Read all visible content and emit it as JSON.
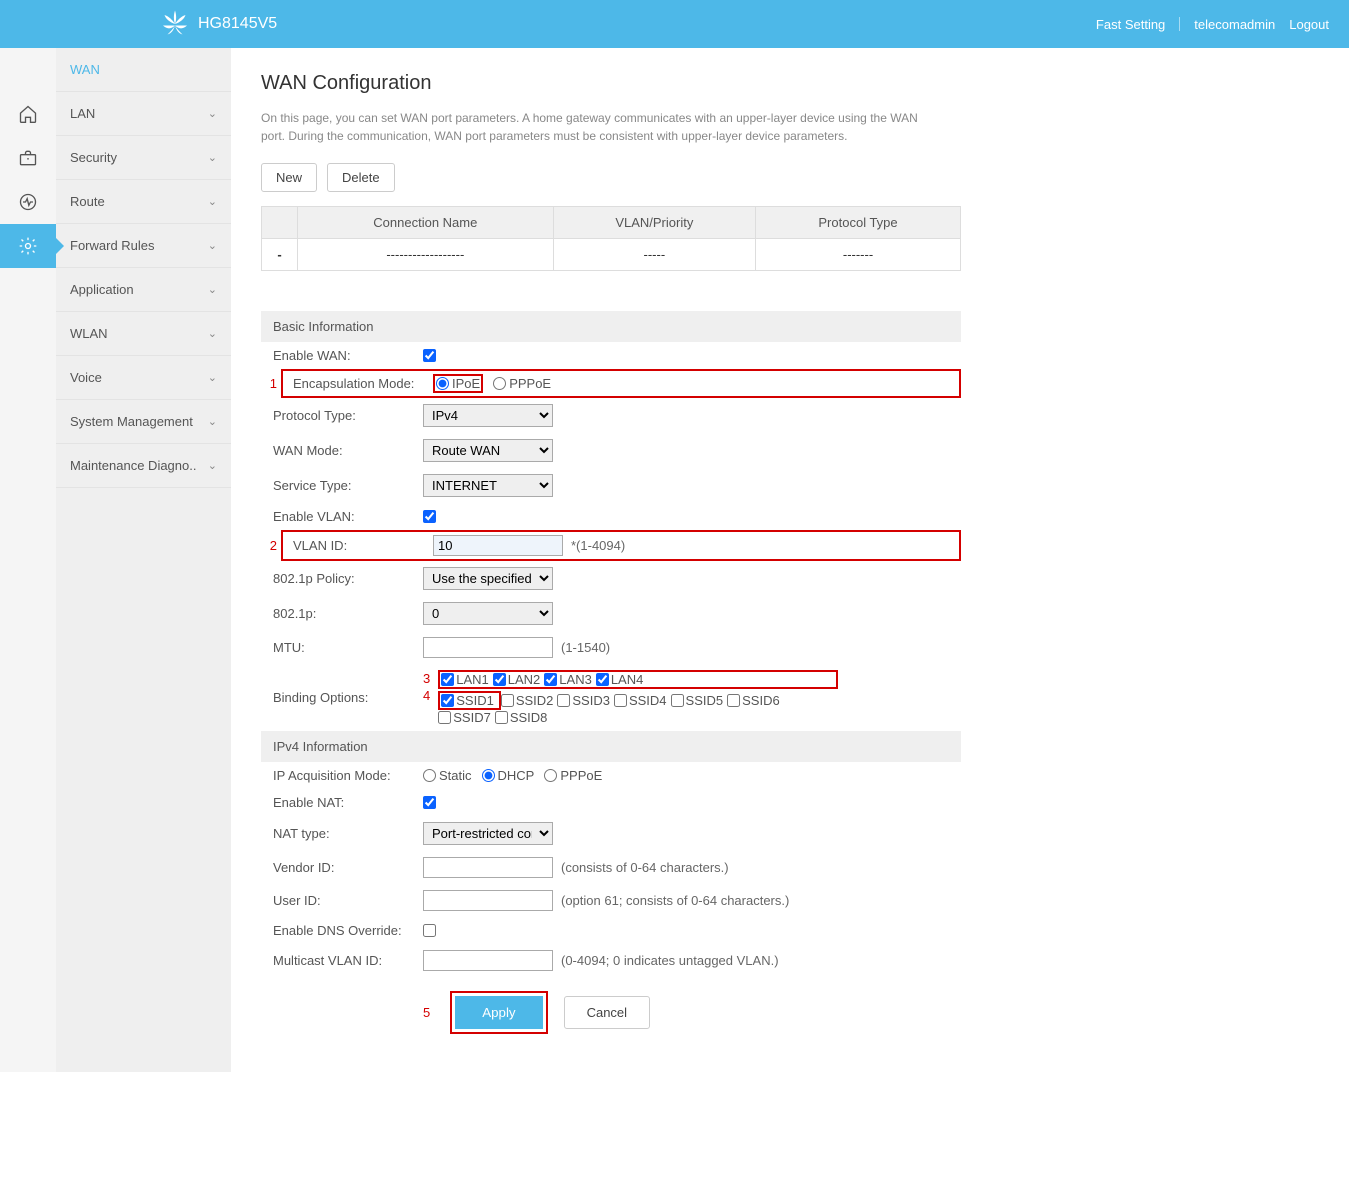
{
  "header": {
    "product": "HG8145V5",
    "fast_setting": "Fast Setting",
    "user": "telecomadmin",
    "logout": "Logout"
  },
  "sidebar": {
    "items": [
      "WAN",
      "LAN",
      "Security",
      "Route",
      "Forward Rules",
      "Application",
      "WLAN",
      "Voice",
      "System Management",
      "Maintenance Diagno.."
    ]
  },
  "page": {
    "title": "WAN Configuration",
    "desc": "On this page, you can set WAN port parameters. A home gateway communicates with an upper-layer device using the WAN port. During the communication, WAN port parameters must be consistent with upper-layer device parameters.",
    "btn_new": "New",
    "btn_delete": "Delete"
  },
  "table": {
    "col_conn": "Connection Name",
    "col_vlan": "VLAN/Priority",
    "col_proto": "Protocol Type",
    "row_mark": "-",
    "row_conn": "------------------",
    "row_vlan": "-----",
    "row_proto": "-------"
  },
  "sections": {
    "basic": "Basic Information",
    "ipv4": "IPv4 Information"
  },
  "labels": {
    "enable_wan": "Enable WAN:",
    "encap": "Encapsulation Mode:",
    "proto_type": "Protocol Type:",
    "wan_mode": "WAN Mode:",
    "service_type": "Service Type:",
    "enable_vlan": "Enable VLAN:",
    "vlan_id": "VLAN ID:",
    "policy": "802.1p Policy:",
    "p_8021p": "802.1p:",
    "mtu": "MTU:",
    "binding": "Binding Options:",
    "ip_acq": "IP Acquisition Mode:",
    "enable_nat": "Enable NAT:",
    "nat_type": "NAT type:",
    "vendor_id": "Vendor ID:",
    "user_id": "User ID:",
    "dns_override": "Enable DNS Override:",
    "multicast_vlan": "Multicast VLAN ID:"
  },
  "options": {
    "ipoe": "IPoE",
    "pppoe": "PPPoE",
    "proto_ipv4": "IPv4",
    "wan_mode_route": "Route WAN",
    "service_internet": "INTERNET",
    "policy_spec": "Use the specified value",
    "p0": "0",
    "static": "Static",
    "dhcp": "DHCP",
    "pppoe2": "PPPoE",
    "nat_type_v": "Port-restricted cone",
    "lan": [
      "LAN1",
      "LAN2",
      "LAN3",
      "LAN4"
    ],
    "ssid": [
      "SSID1",
      "SSID2",
      "SSID3",
      "SSID4",
      "SSID5",
      "SSID6",
      "SSID7",
      "SSID8"
    ]
  },
  "values": {
    "vlan_id": "10",
    "mtu": "",
    "vendor_id": "",
    "user_id": "",
    "multicast_vlan": ""
  },
  "hints": {
    "vlan": "*(1-4094)",
    "mtu": "(1-1540)",
    "vendor": "(consists of 0-64 characters.)",
    "user": "(option 61; consists of 0-64 characters.)",
    "multicast": "(0-4094; 0 indicates untagged VLAN.)"
  },
  "actions": {
    "apply": "Apply",
    "cancel": "Cancel"
  },
  "annot": {
    "a1": "1",
    "a2": "2",
    "a3": "3",
    "a4": "4",
    "a5": "5"
  }
}
